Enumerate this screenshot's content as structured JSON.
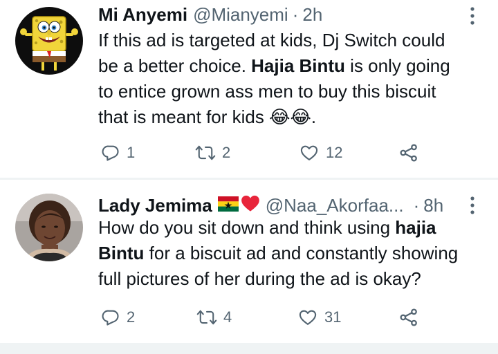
{
  "tweets": [
    {
      "name": "Mi Anyemi",
      "handle": "@Mianyemi",
      "separator": "·",
      "time": "2h",
      "lines": [
        [
          {
            "t": "If this ad is targeted at kids, Dj Switch could"
          }
        ],
        [
          {
            "t": "be a better choice. "
          },
          {
            "t": "Hajia Bintu",
            "b": true
          },
          {
            "t": " is only going"
          }
        ],
        [
          {
            "t": "to entice grown ass men to buy this biscuit"
          }
        ],
        [
          {
            "t": "that is meant for kids "
          },
          {
            "t": "😂😂",
            "emoji": true
          },
          {
            "t": "."
          }
        ]
      ],
      "replies": "1",
      "retweets": "2",
      "likes": "12"
    },
    {
      "name": "Lady Jemima",
      "handle": "@Naa_Akorfaa...",
      "separator": "·",
      "time": "8h",
      "flag_emojis": [
        "ghana-flag",
        "red-heart"
      ],
      "lines": [
        [
          {
            "t": "How do you sit down and think using "
          },
          {
            "t": "hajia",
            "b": true
          }
        ],
        [
          {
            "t": "Bintu",
            "b": true
          },
          {
            "t": " for a biscuit ad and constantly showing"
          }
        ],
        [
          {
            "t": "full pictures of her during the ad is okay?"
          }
        ]
      ],
      "replies": "2",
      "retweets": "4",
      "likes": "31"
    }
  ],
  "colors": {
    "text": "#0f1419",
    "muted": "#536471",
    "divider": "#eff3f4",
    "ghana_red": "#ce1126",
    "ghana_gold": "#fcd116",
    "ghana_green": "#006b3f",
    "heart_red": "#e8253b"
  }
}
